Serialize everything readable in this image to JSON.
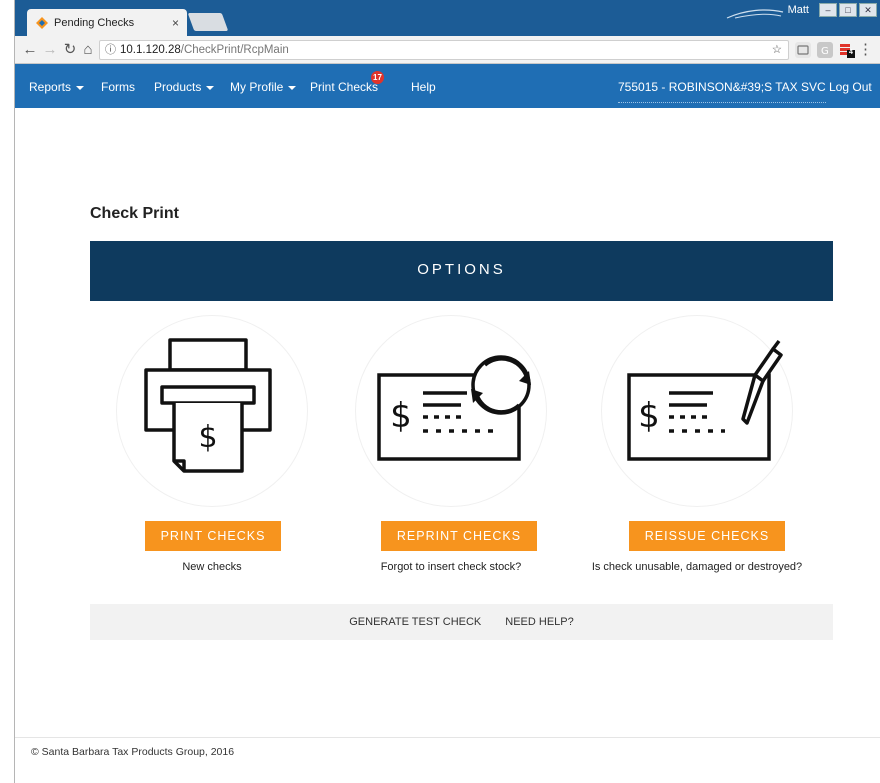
{
  "browser": {
    "tab_title": "Pending Checks",
    "tab_close": "×",
    "profile_name": "Matt",
    "url_host": "10.1.120.28",
    "url_path": "/CheckPrint/RcpMain",
    "ext_badge": "4"
  },
  "nav": {
    "items": [
      {
        "label": "Reports",
        "dropdown": true
      },
      {
        "label": "Forms",
        "dropdown": false
      },
      {
        "label": "Products",
        "dropdown": true
      },
      {
        "label": "My Profile",
        "dropdown": true
      },
      {
        "label": "Print Checks",
        "dropdown": false
      },
      {
        "label": "Help",
        "dropdown": false
      }
    ],
    "badge_count": "17",
    "account": "755015 - ROBINSON&#39;S TAX SVC",
    "logout": "Log Out"
  },
  "page": {
    "title": "Check Print",
    "options_banner": "OPTIONS"
  },
  "options": [
    {
      "icon": "printer-check-icon",
      "button": "PRINT CHECKS",
      "description": "New checks"
    },
    {
      "icon": "reprint-check-icon",
      "button": "REPRINT CHECKS",
      "description": "Forgot to insert check stock?"
    },
    {
      "icon": "check-pen-icon",
      "button": "REISSUE CHECKS",
      "description": "Is check unusable, damaged or destroyed?"
    }
  ],
  "links": {
    "test_check": "GENERATE TEST CHECK",
    "help": "NEED HELP?"
  },
  "footer": "© Santa Barbara Tax Products Group, 2016",
  "colors": {
    "nav_bg": "#1f6eb4",
    "banner_bg": "#0e3a5e",
    "button_orange": "#f7941e",
    "badge_red": "#e0342b"
  }
}
